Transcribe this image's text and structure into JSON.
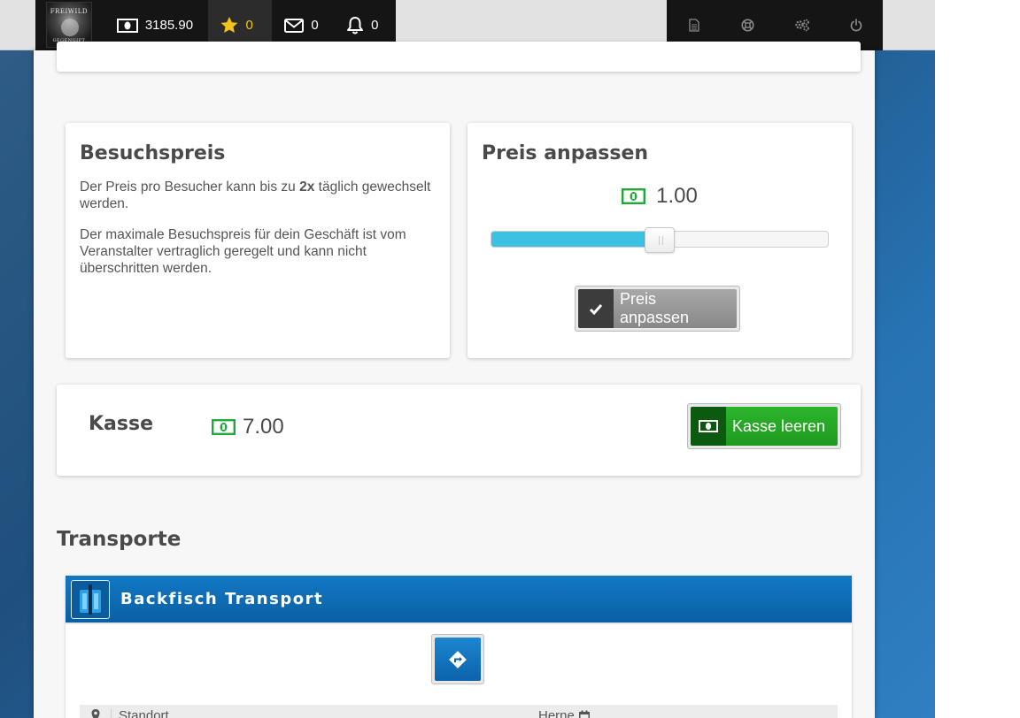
{
  "topbar": {
    "logo_text_top": "FREIWILD",
    "logo_text_bottom": "GEGENGIFT",
    "money": "3185.90",
    "stars": "0",
    "messages": "0",
    "notifications": "0",
    "right_icons": [
      "document-icon",
      "lifebuoy-icon",
      "gears-icon",
      "power-icon"
    ]
  },
  "besuchspreis": {
    "title": "Besuchspreis",
    "text1_pre": "Der Preis pro Besucher kann bis zu ",
    "text1_bold": "2x",
    "text1_post": " täglich gewechselt werden.",
    "text2": "Der maximale Besuchspreis für dein Geschäft ist vom Veranstalter vertraglich geregelt und kann nicht überschritten werden."
  },
  "preis_anpassen": {
    "title": "Preis anpassen",
    "value": "1.00",
    "slider_fraction": 0.5,
    "button_label": "Preis anpassen"
  },
  "kasse": {
    "title": "Kasse",
    "amount": "7.00",
    "button_label": "Kasse leeren"
  },
  "transporte": {
    "section_title": "Transporte",
    "items": [
      {
        "name": "Backfisch Transport",
        "location_label": "Standort",
        "location_value": "Herne"
      }
    ]
  },
  "colors": {
    "accent_blue": "#0a5fa3",
    "slider_fill": "#3cc1e3",
    "money_green": "#22a83a",
    "star_yellow": "#f3c417",
    "button_green": "#1f9a1f"
  }
}
